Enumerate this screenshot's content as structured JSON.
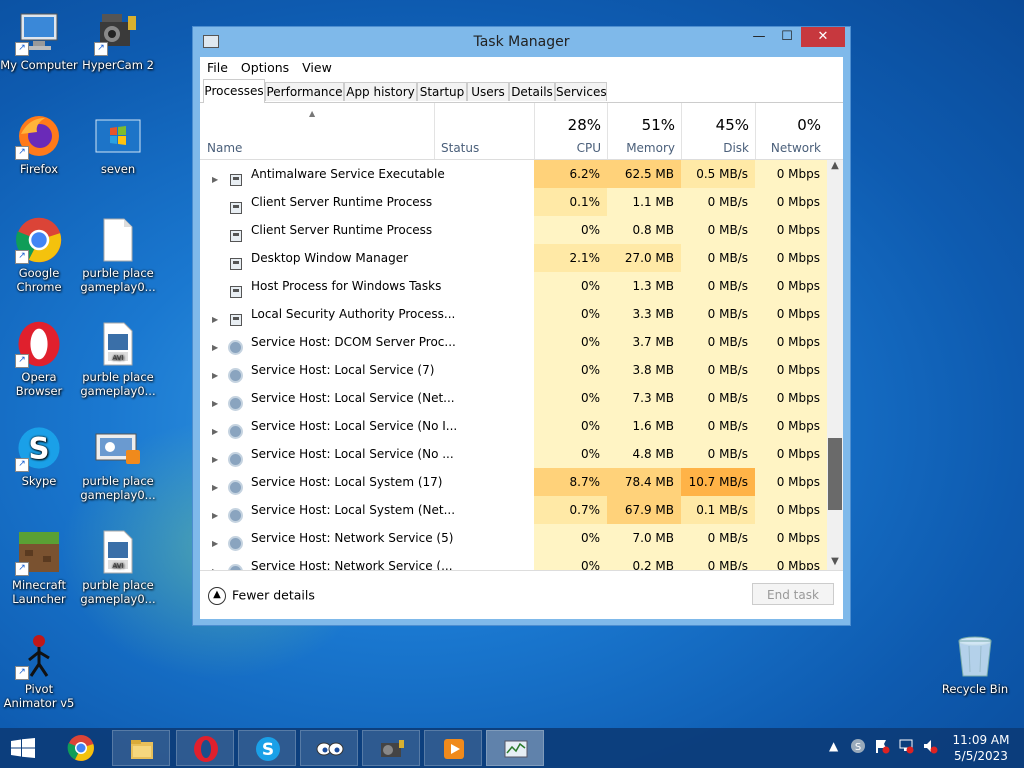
{
  "desktop": {
    "icons": [
      {
        "label": "My Computer",
        "icon": "computer-icon"
      },
      {
        "label": "HyperCam 2",
        "icon": "hypercam-icon"
      },
      {
        "label": "Firefox",
        "icon": "firefox-icon"
      },
      {
        "label": "seven",
        "icon": "windows-image-icon"
      },
      {
        "label": "Google Chrome",
        "icon": "chrome-icon"
      },
      {
        "label": "purble place gameplay0...",
        "icon": "blank-file-icon"
      },
      {
        "label": "Opera Browser",
        "icon": "opera-icon"
      },
      {
        "label": "purble place gameplay0...",
        "icon": "avi-file-icon"
      },
      {
        "label": "Skype",
        "icon": "skype-icon"
      },
      {
        "label": "purble place gameplay0...",
        "icon": "movie-thumbnail-icon"
      },
      {
        "label": "Minecraft Launcher",
        "icon": "minecraft-icon"
      },
      {
        "label": "purble place gameplay0...",
        "icon": "avi-file-icon"
      },
      {
        "label": "Pivot Animator v5",
        "icon": "stickman-icon"
      },
      {
        "label": "Recycle Bin",
        "icon": "recycle-bin-icon"
      }
    ]
  },
  "window": {
    "title": "Task Manager",
    "minimize": "—",
    "maximize": "☐",
    "close": "✕"
  },
  "menu": [
    "File",
    "Options",
    "View"
  ],
  "tabs": [
    "Processes",
    "Performance",
    "App history",
    "Startup",
    "Users",
    "Details",
    "Services"
  ],
  "active_tab": "Processes",
  "columns": {
    "name": "Name",
    "status": "Status",
    "cpu": {
      "pct": "28%",
      "label": "CPU"
    },
    "memory": {
      "pct": "51%",
      "label": "Memory"
    },
    "disk": {
      "pct": "45%",
      "label": "Disk"
    },
    "network": {
      "pct": "0%",
      "label": "Network"
    }
  },
  "processes": [
    {
      "name": "Antimalware Service Executable",
      "cpu": "6.2%",
      "memory": "62.5 MB",
      "disk": "0.5 MB/s",
      "network": "0 Mbps",
      "expandable": true,
      "icon": "window-icon"
    },
    {
      "name": "Client Server Runtime Process",
      "cpu": "0.1%",
      "memory": "1.1 MB",
      "disk": "0 MB/s",
      "network": "0 Mbps",
      "expandable": false,
      "icon": "window-icon"
    },
    {
      "name": "Client Server Runtime Process",
      "cpu": "0%",
      "memory": "0.8 MB",
      "disk": "0 MB/s",
      "network": "0 Mbps",
      "expandable": false,
      "icon": "window-icon"
    },
    {
      "name": "Desktop Window Manager",
      "cpu": "2.1%",
      "memory": "27.0 MB",
      "disk": "0 MB/s",
      "network": "0 Mbps",
      "expandable": false,
      "icon": "window-icon"
    },
    {
      "name": "Host Process for Windows Tasks",
      "cpu": "0%",
      "memory": "1.3 MB",
      "disk": "0 MB/s",
      "network": "0 Mbps",
      "expandable": false,
      "icon": "window-icon"
    },
    {
      "name": "Local Security Authority Process...",
      "cpu": "0%",
      "memory": "3.3 MB",
      "disk": "0 MB/s",
      "network": "0 Mbps",
      "expandable": true,
      "icon": "window-icon"
    },
    {
      "name": "Service Host: DCOM Server Proc...",
      "cpu": "0%",
      "memory": "3.7 MB",
      "disk": "0 MB/s",
      "network": "0 Mbps",
      "expandable": true,
      "icon": "gear-icon"
    },
    {
      "name": "Service Host: Local Service (7)",
      "cpu": "0%",
      "memory": "3.8 MB",
      "disk": "0 MB/s",
      "network": "0 Mbps",
      "expandable": true,
      "icon": "gear-icon"
    },
    {
      "name": "Service Host: Local Service (Net...",
      "cpu": "0%",
      "memory": "7.3 MB",
      "disk": "0 MB/s",
      "network": "0 Mbps",
      "expandable": true,
      "icon": "gear-icon"
    },
    {
      "name": "Service Host: Local Service (No I...",
      "cpu": "0%",
      "memory": "1.6 MB",
      "disk": "0 MB/s",
      "network": "0 Mbps",
      "expandable": true,
      "icon": "gear-icon"
    },
    {
      "name": "Service Host: Local Service (No ...",
      "cpu": "0%",
      "memory": "4.8 MB",
      "disk": "0 MB/s",
      "network": "0 Mbps",
      "expandable": true,
      "icon": "gear-icon"
    },
    {
      "name": "Service Host: Local System (17)",
      "cpu": "8.7%",
      "memory": "78.4 MB",
      "disk": "10.7 MB/s",
      "network": "0 Mbps",
      "expandable": true,
      "icon": "gear-icon"
    },
    {
      "name": "Service Host: Local System (Net...",
      "cpu": "0.7%",
      "memory": "67.9 MB",
      "disk": "0.1 MB/s",
      "network": "0 Mbps",
      "expandable": true,
      "icon": "gear-icon"
    },
    {
      "name": "Service Host: Network Service (5)",
      "cpu": "0%",
      "memory": "7.0 MB",
      "disk": "0 MB/s",
      "network": "0 Mbps",
      "expandable": true,
      "icon": "gear-icon"
    },
    {
      "name": "Service Host: Network Service (...",
      "cpu": "0%",
      "memory": "0.2 MB",
      "disk": "0 MB/s",
      "network": "0 Mbps",
      "expandable": true,
      "icon": "gear-icon"
    }
  ],
  "footer": {
    "fewer_details": "Fewer details",
    "end_task": "End task"
  },
  "taskbar": {
    "items": [
      "start-icon",
      "chrome-icon",
      "file-explorer-icon",
      "opera-icon",
      "skype-icon",
      "eyes-icon",
      "hypercam-icon",
      "media-player-icon",
      "task-manager-icon"
    ],
    "time": "11:09 AM",
    "date": "5/5/2023"
  },
  "colors": {
    "heat_light": "#fff4c4",
    "heat_mid": "#ffe9a6",
    "heat_high": "#ffd27a",
    "heat_hot": "#ffb347",
    "close_button": "#c7383e"
  }
}
